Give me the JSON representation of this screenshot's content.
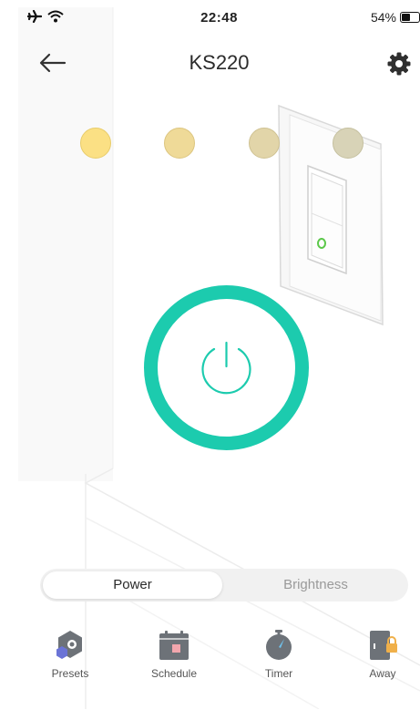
{
  "status_bar": {
    "time": "22:48",
    "battery_percent_label": "54%",
    "battery_level": 0.54
  },
  "header": {
    "title": "KS220",
    "back_icon": "arrow-left-icon",
    "settings_icon": "gear-icon"
  },
  "brightness_presets": {
    "colors": [
      "#fbe084",
      "#efda98",
      "#e2d5a9",
      "#d8d3b7"
    ]
  },
  "power": {
    "accent_color": "#1ccbae",
    "icon": "power-icon"
  },
  "mode_tabs": {
    "power_label": "Power",
    "brightness_label": "Brightness",
    "selected": "Power"
  },
  "bottom_nav": {
    "presets_label": "Presets",
    "schedule_label": "Schedule",
    "timer_label": "Timer",
    "away_label": "Away"
  }
}
